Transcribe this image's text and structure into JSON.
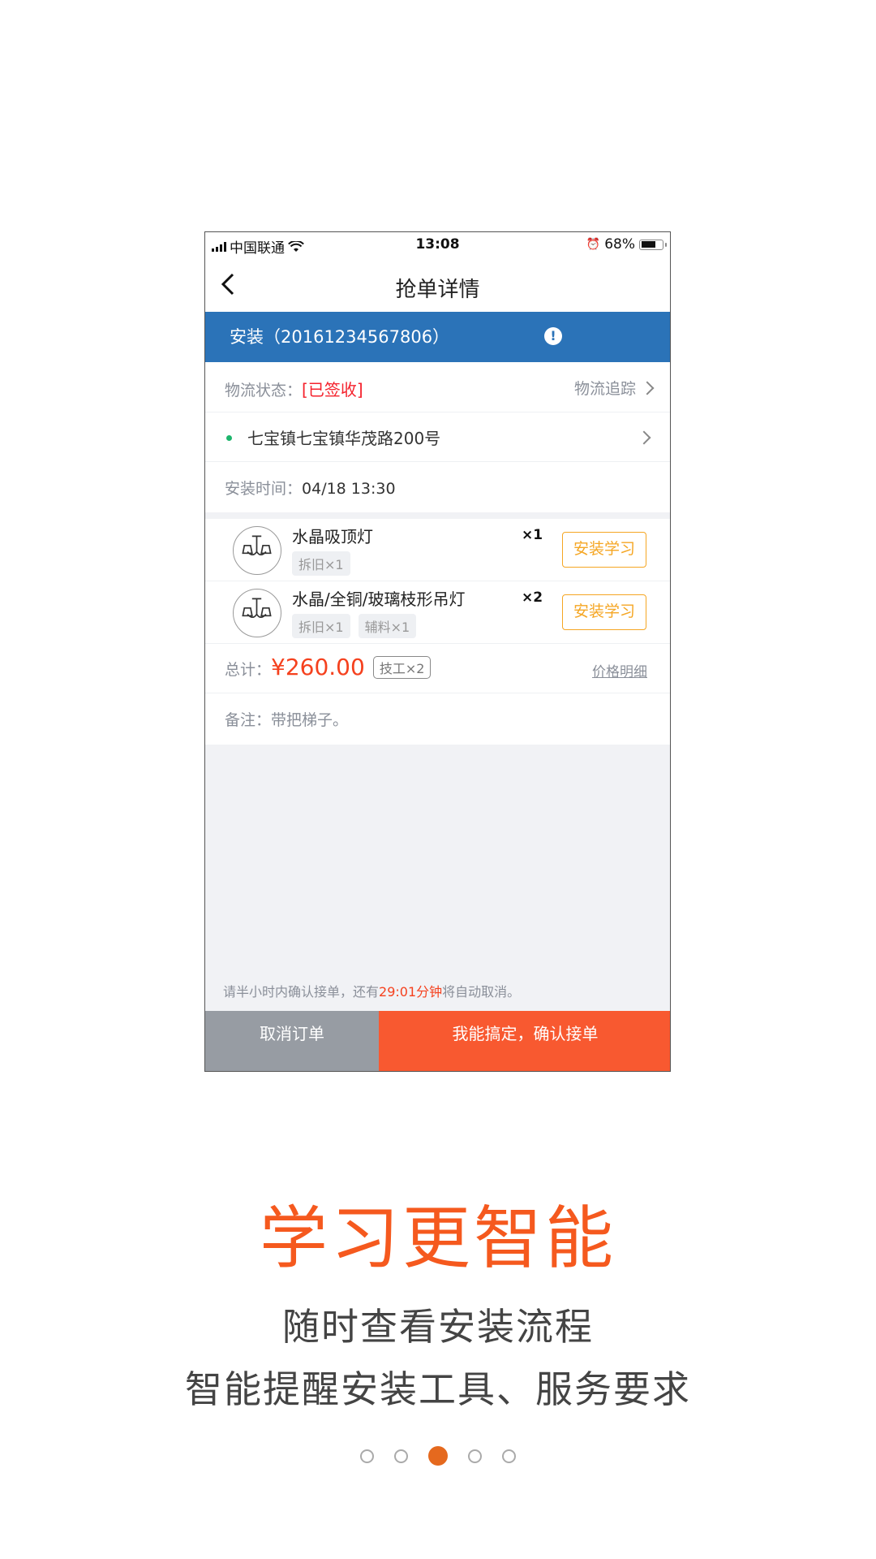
{
  "status_bar": {
    "carrier": "中国联通",
    "time": "13:08",
    "battery": "68%",
    "battery_level": 0.68
  },
  "nav": {
    "title": "抢单详情"
  },
  "order": {
    "header": "安装（20161234567806）"
  },
  "logistics": {
    "label": "物流状态：",
    "value": "[已签收]",
    "track_label": "物流追踪"
  },
  "address": {
    "text": "七宝镇七宝镇华茂路200号"
  },
  "install_time": {
    "label": "安装时间：",
    "value": "04/18 13:30"
  },
  "items": [
    {
      "name": "水晶吸顶灯",
      "qty": "×1",
      "tags": [
        "拆旧×1"
      ],
      "button": "安装学习"
    },
    {
      "name": "水晶/全铜/玻璃枝形吊灯",
      "qty": "×2",
      "tags": [
        "拆旧×1",
        "辅料×1"
      ],
      "button": "安装学习"
    }
  ],
  "total": {
    "label": "总计：",
    "amount": "¥260.00",
    "labor_tag": "技工×2",
    "detail_link": "价格明细"
  },
  "note": {
    "label": "备注：",
    "text": "带把梯子。"
  },
  "notice": {
    "prefix": "请半小时内确认接单，还有",
    "countdown": "29:01分钟",
    "suffix": "将自动取消。"
  },
  "actions": {
    "cancel": "取消订单",
    "confirm": "我能搞定，确认接单"
  },
  "promo": {
    "headline": "学习更智能",
    "line1": "随时查看安装流程",
    "line2": "智能提醒安装工具、服务要求"
  },
  "pagination": {
    "total": 5,
    "active_index": 2
  },
  "colors": {
    "blue": "#2b73b8",
    "accent": "#f85930",
    "orange": "#f5a623",
    "headline": "#f5591e"
  }
}
